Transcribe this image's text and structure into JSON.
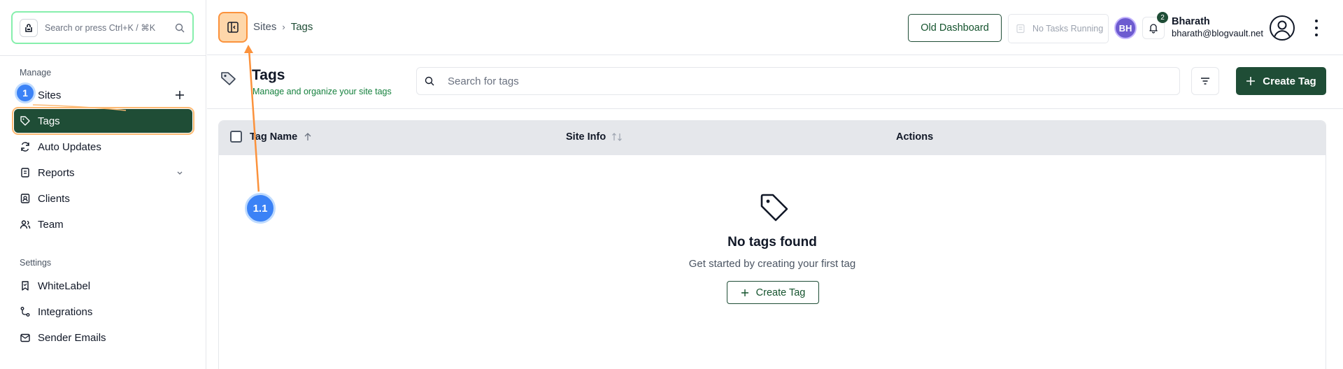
{
  "sidebar": {
    "search_placeholder": "Search or press Ctrl+K / ⌘K",
    "manage_label": "Manage",
    "settings_label": "Settings",
    "items": [
      {
        "label": "Sites",
        "icon": "globe-icon"
      },
      {
        "label": "Tags",
        "icon": "tag-icon",
        "active": true
      },
      {
        "label": "Auto Updates",
        "icon": "refresh-icon"
      },
      {
        "label": "Reports",
        "icon": "report-icon"
      },
      {
        "label": "Clients",
        "icon": "client-icon"
      },
      {
        "label": "Team",
        "icon": "team-icon"
      }
    ],
    "settings_items": [
      {
        "label": "WhiteLabel",
        "icon": "bookmark-icon"
      },
      {
        "label": "Integrations",
        "icon": "integrations-icon"
      },
      {
        "label": "Sender Emails",
        "icon": "mail-icon"
      }
    ]
  },
  "header": {
    "breadcrumb": {
      "parent": "Sites",
      "current": "Tags",
      "separator": "›"
    },
    "old_dashboard": "Old Dashboard",
    "tasks_status": "No Tasks Running",
    "avatar_initials": "BH",
    "notification_count": "2",
    "user": {
      "name": "Bharath",
      "email": "bharath@blogvault.net"
    }
  },
  "page": {
    "title": "Tags",
    "subtitle": "Manage and organize your site tags",
    "search_placeholder": "Search for tags",
    "create_button": "Create Tag"
  },
  "table": {
    "columns": [
      "Tag Name",
      "Site Info",
      "Actions"
    ],
    "empty": {
      "title": "No tags found",
      "subtitle": "Get started by creating your first tag",
      "button": "Create Tag"
    }
  },
  "annotations": {
    "step_1": "1",
    "step_1_1": "1.1"
  },
  "colors": {
    "brand_green": "#1f4d36",
    "highlight_orange": "#fb923c",
    "annotation_blue": "#3b82f6",
    "avatar_purple": "#6d5bd0"
  }
}
